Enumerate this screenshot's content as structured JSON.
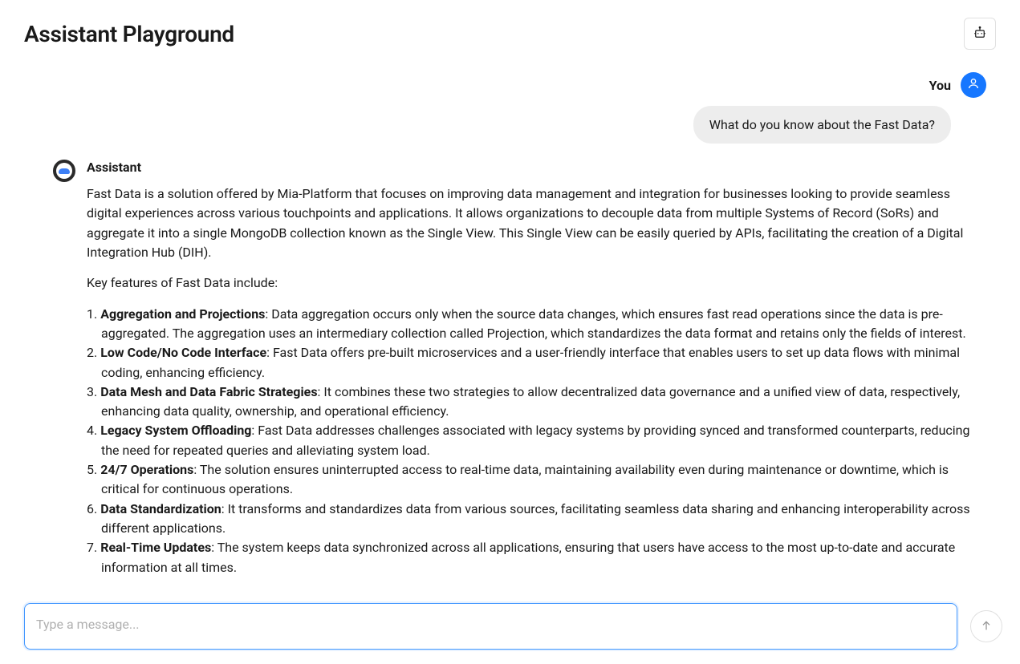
{
  "header": {
    "title": "Assistant Playground"
  },
  "chat": {
    "user": {
      "label": "You",
      "message": "What do you know about the Fast Data?"
    },
    "assistant": {
      "label": "Assistant",
      "intro": "Fast Data is a solution offered by Mia-Platform that focuses on improving data management and integration for businesses looking to provide seamless digital experiences across various touchpoints and applications. It allows organizations to decouple data from multiple Systems of Record (SoRs) and aggregate it into a single MongoDB collection known as the Single View. This Single View can be easily queried by APIs, facilitating the creation of a Digital Integration Hub (DIH).",
      "features_heading": "Key features of Fast Data include:",
      "items": [
        {
          "title": "Aggregation and Projections",
          "text": ": Data aggregation occurs only when the source data changes, which ensures fast read operations since the data is pre-aggregated. The aggregation uses an intermediary collection called Projection, which standardizes the data format and retains only the fields of interest."
        },
        {
          "title": "Low Code/No Code Interface",
          "text": ": Fast Data offers pre-built microservices and a user-friendly interface that enables users to set up data flows with minimal coding, enhancing efficiency."
        },
        {
          "title": "Data Mesh and Data Fabric Strategies",
          "text": ": It combines these two strategies to allow decentralized data governance and a unified view of data, respectively, enhancing data quality, ownership, and operational efficiency."
        },
        {
          "title": "Legacy System Offloading",
          "text": ": Fast Data addresses challenges associated with legacy systems by providing synced and transformed counterparts, reducing the need for repeated queries and alleviating system load."
        },
        {
          "title": "24/7 Operations",
          "text": ": The solution ensures uninterrupted access to real-time data, maintaining availability even during maintenance or downtime, which is critical for continuous operations."
        },
        {
          "title": "Data Standardization",
          "text": ": It transforms and standardizes data from various sources, facilitating seamless data sharing and enhancing interoperability across different applications."
        },
        {
          "title": "Real-Time Updates",
          "text": ": The system keeps data synchronized across all applications, ensuring that users have access to the most up-to-date and accurate information at all times."
        }
      ]
    }
  },
  "input": {
    "placeholder": "Type a message..."
  }
}
